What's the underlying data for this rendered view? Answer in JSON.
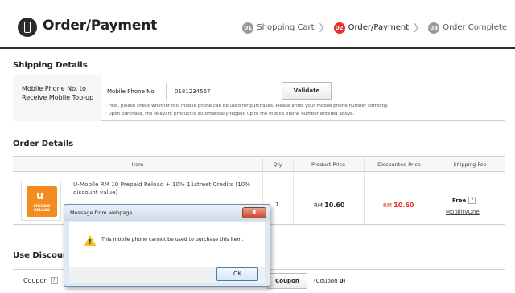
{
  "header": {
    "title": "Order/Payment",
    "steps": [
      {
        "num": "01",
        "label": "Shopping Cart"
      },
      {
        "num": "02",
        "label": "Order/Payment"
      },
      {
        "num": "03",
        "label": "Order Complete"
      }
    ],
    "separator": "〉"
  },
  "shipping": {
    "section_title": "Shipping Details",
    "row_label": "Mobile Phone No. to Receive Mobile Top-up",
    "phone_label": "Mobile Phone No.",
    "phone_value": "0181234567",
    "validate_label": "Validate",
    "notes": [
      "First, please check whether this mobile phone can be used for purchases. Please enter your mobile phone number correctly.",
      "Upon purchase, the relevant product is automatically topped up to the mobile phone number entered above."
    ]
  },
  "order": {
    "section_title": "Order Details",
    "columns": [
      "Item",
      "Qty",
      "Product Price",
      "Discounted Price",
      "Shipping Fee"
    ],
    "item": {
      "image_badge_letter": "u",
      "image_badge_text": "PREPAID RELOAD",
      "name": "U-Mobile RM 10 Prepaid Reload + 10% 11street Credits (10% discount value)",
      "qty": "1",
      "currency": "RM",
      "price": "10.60",
      "discounted_price": "10.60",
      "shipping_fee": "Free",
      "shipper": "MobilityOne"
    }
  },
  "discount": {
    "section_title": "Use Discount",
    "coupon_label": "Coupon",
    "coupon_button": "Coupon",
    "coupon_count_prefix": "(Coupon ",
    "coupon_count": "0",
    "coupon_count_suffix": ")"
  },
  "dialog": {
    "title": "Message from webpage",
    "close_glyph": "X",
    "message": "This mobile phone cannot be used to purchase this item.",
    "ok_label": "OK",
    "warning_mark": "!"
  },
  "colors": {
    "accent_red": "#e8302f",
    "step_gray": "#9a9a9a",
    "badge_orange": "#f28c1f"
  },
  "icons": {
    "logo": "phone-receipt-icon",
    "help": "question-mark-icon",
    "dialog": "warning-icon"
  }
}
